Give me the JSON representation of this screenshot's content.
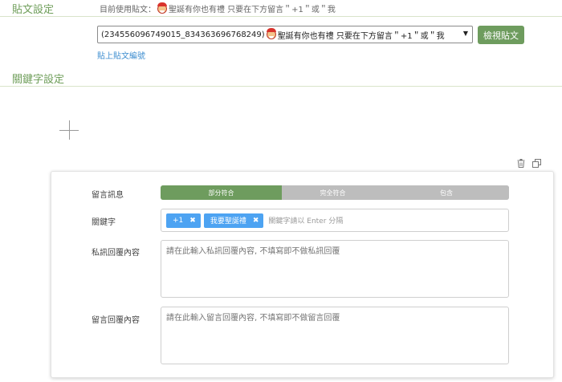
{
  "post_settings": {
    "title": "貼文設定",
    "current_label": "目前使用貼文：",
    "current_text": "聖誕有你也有禮 只要在下方留言＂+1＂或＂我",
    "select_prefix": "(234556096749015_834363696768249)",
    "select_text": "聖誕有你也有禮 只要在下方留言＂+1＂或＂我",
    "view_button": "檢視貼文",
    "edit_link": "貼上貼文編號"
  },
  "keyword_settings": {
    "title": "關鍵字設定"
  },
  "rule": {
    "comment_label": "留言訊息",
    "match_options": [
      "部分符合",
      "完全符合",
      "包含"
    ],
    "selected_match": "部分符合",
    "keyword_label": "關鍵字",
    "keywords": [
      "+1",
      "我要聖誕禮"
    ],
    "keyword_placeholder": "關鍵字請以 Enter 分隔",
    "private_reply_label": "私訊回覆內容",
    "private_reply_placeholder": "請在此輸入私訊回覆內容, 不填寫即不做私訊回覆",
    "comment_reply_label": "留言回覆內容",
    "comment_reply_placeholder": "請在此輸入留言回覆內容, 不填寫即不做留言回覆"
  },
  "colors": {
    "accent_green": "#6e9c5e",
    "tag_blue": "#4da3f2",
    "segment_inactive": "#bdbdbd",
    "link_blue": "#3e8ed0"
  }
}
